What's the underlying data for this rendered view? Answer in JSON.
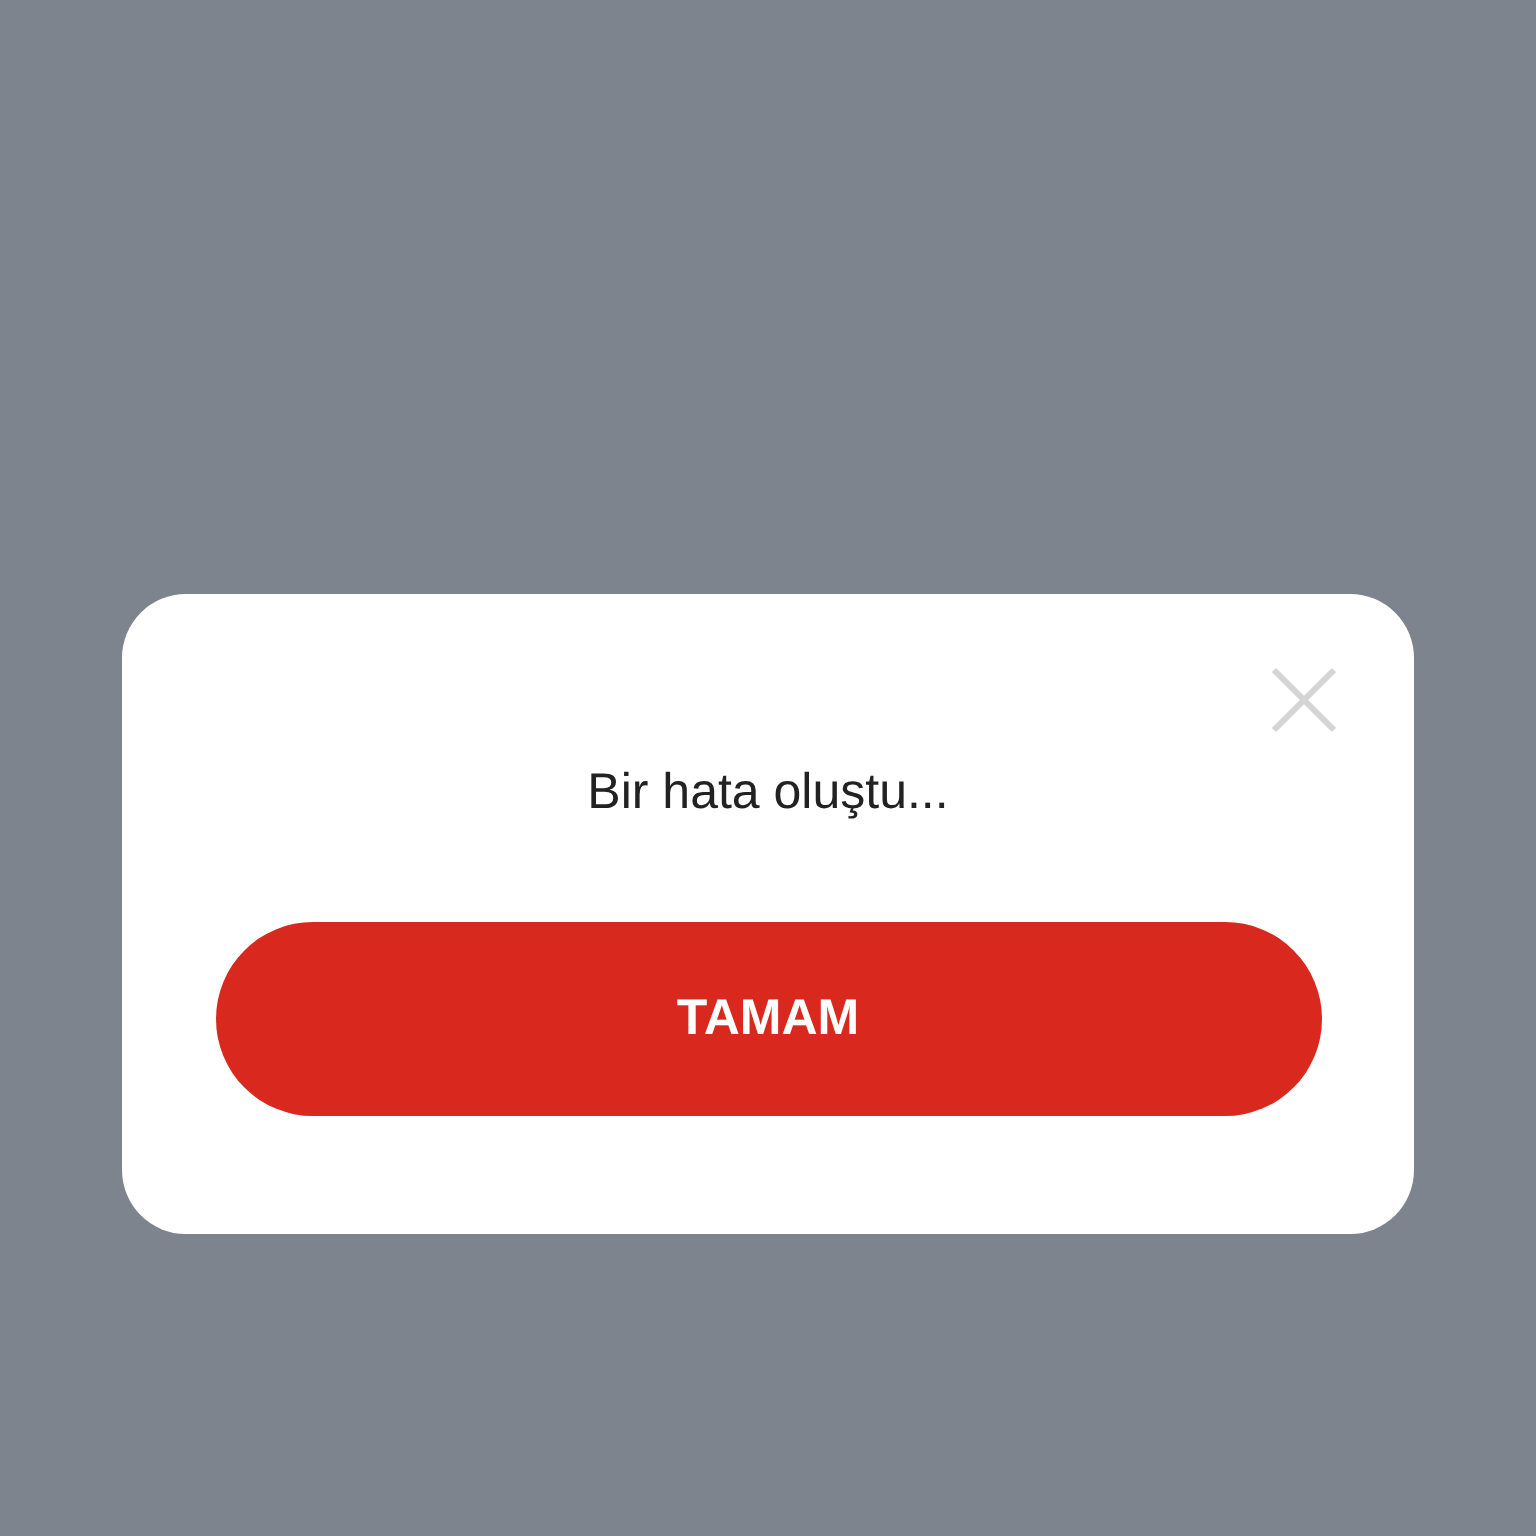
{
  "dialog": {
    "message": "Bir hata oluştu...",
    "button": "TAMAM"
  }
}
